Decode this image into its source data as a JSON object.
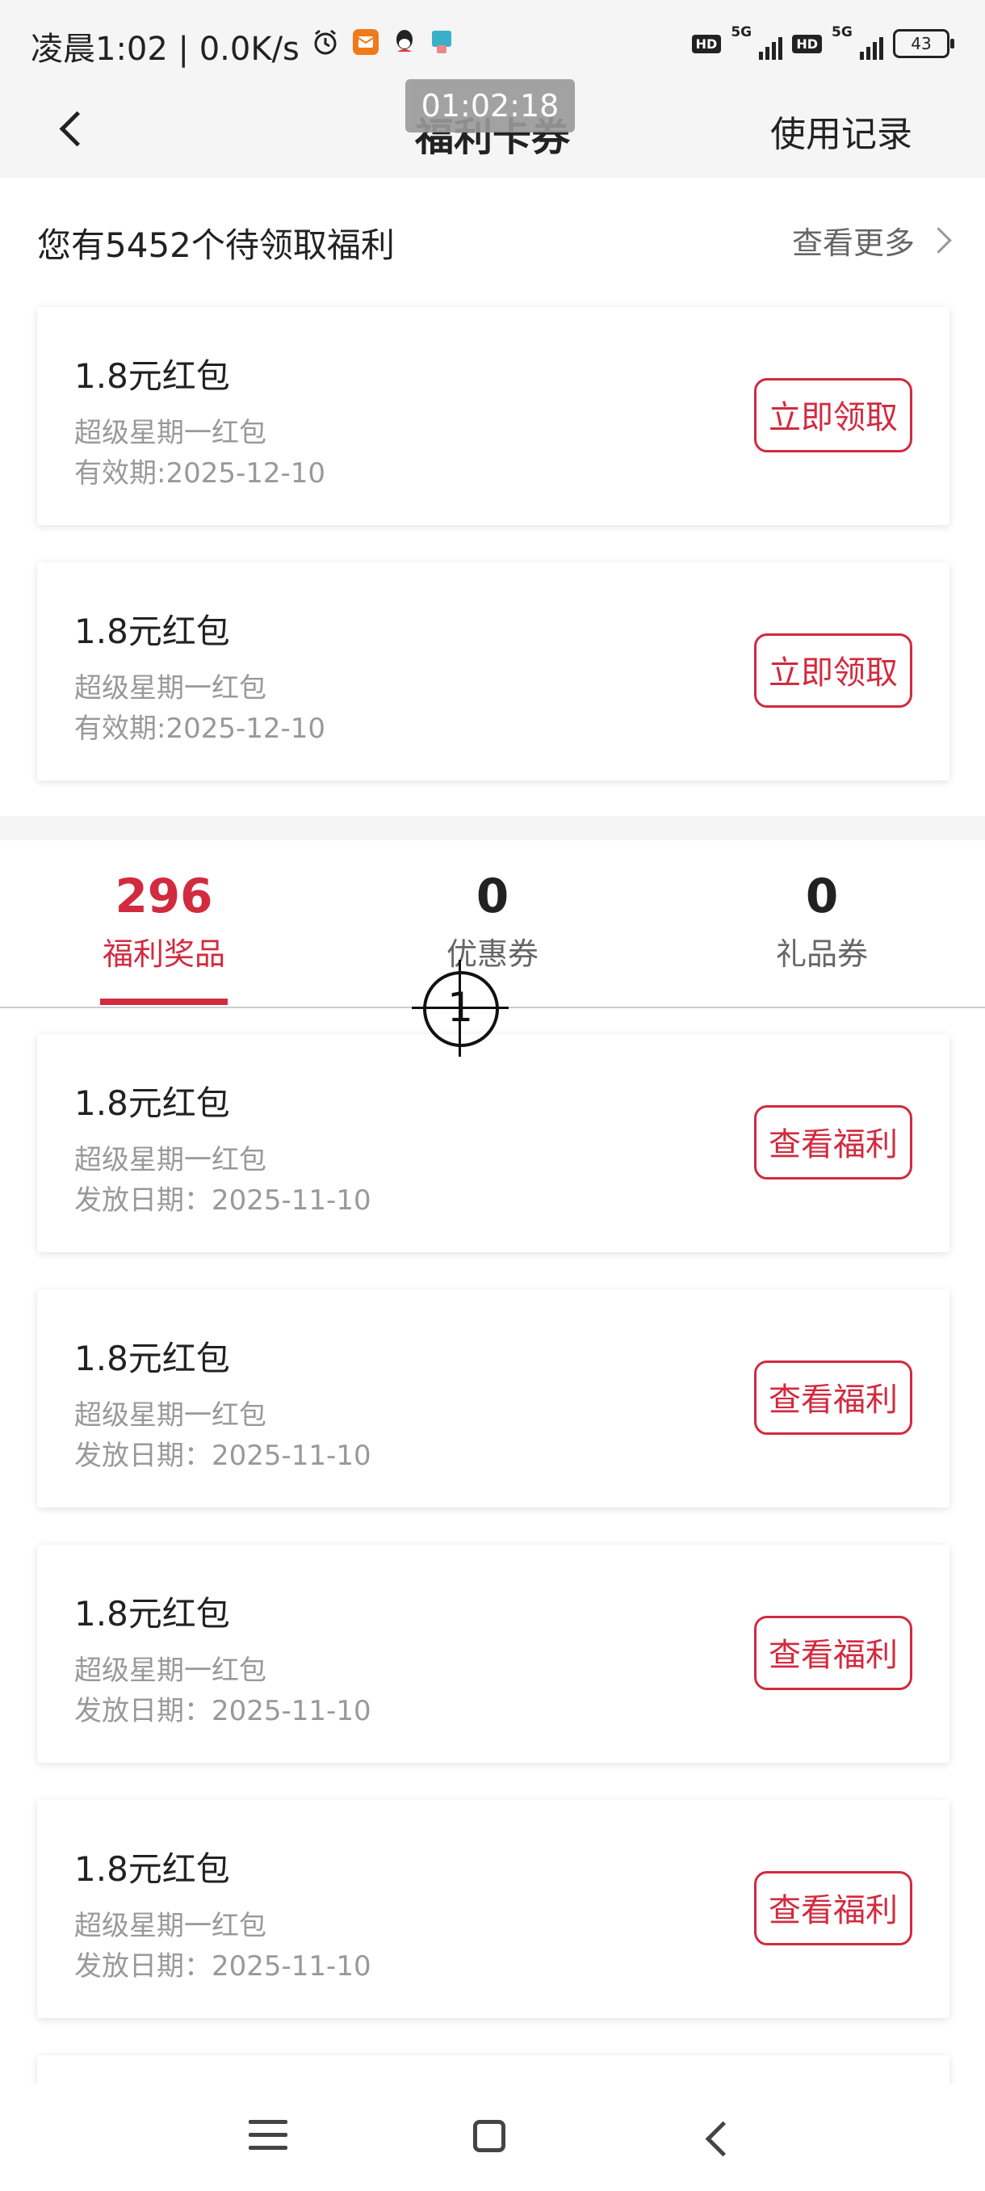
{
  "status_bar": {
    "time_speed": "凌晨1:02 | 0.0K/s",
    "hd1": "HD",
    "net1": "5G",
    "hd2": "HD",
    "net2": "5G",
    "battery": "43"
  },
  "header": {
    "title": "福利卡券",
    "timer": "01:02:18",
    "history": "使用记录"
  },
  "pending": {
    "title": "您有5452个待领取福利",
    "see_more": "查看更多",
    "items": [
      {
        "title": "1.8元红包",
        "sub": "超级星期一红包",
        "date": "有效期:2025-12-10",
        "button": "立即领取"
      },
      {
        "title": "1.8元红包",
        "sub": "超级星期一红包",
        "date": "有效期:2025-12-10",
        "button": "立即领取"
      }
    ]
  },
  "tabs": [
    {
      "count": "296",
      "label": "福利奖品"
    },
    {
      "count": "0",
      "label": "优惠券"
    },
    {
      "count": "0",
      "label": "礼品券"
    }
  ],
  "overlay_marker": "1",
  "rewards": [
    {
      "title": "1.8元红包",
      "sub": "超级星期一红包",
      "date": "发放日期：2025-11-10",
      "button": "查看福利"
    },
    {
      "title": "1.8元红包",
      "sub": "超级星期一红包",
      "date": "发放日期：2025-11-10",
      "button": "查看福利"
    },
    {
      "title": "1.8元红包",
      "sub": "超级星期一红包",
      "date": "发放日期：2025-11-10",
      "button": "查看福利"
    },
    {
      "title": "1.8元红包",
      "sub": "超级星期一红包",
      "date": "发放日期：2025-11-10",
      "button": "查看福利"
    }
  ],
  "colors": {
    "accent": "#d22a3f"
  }
}
